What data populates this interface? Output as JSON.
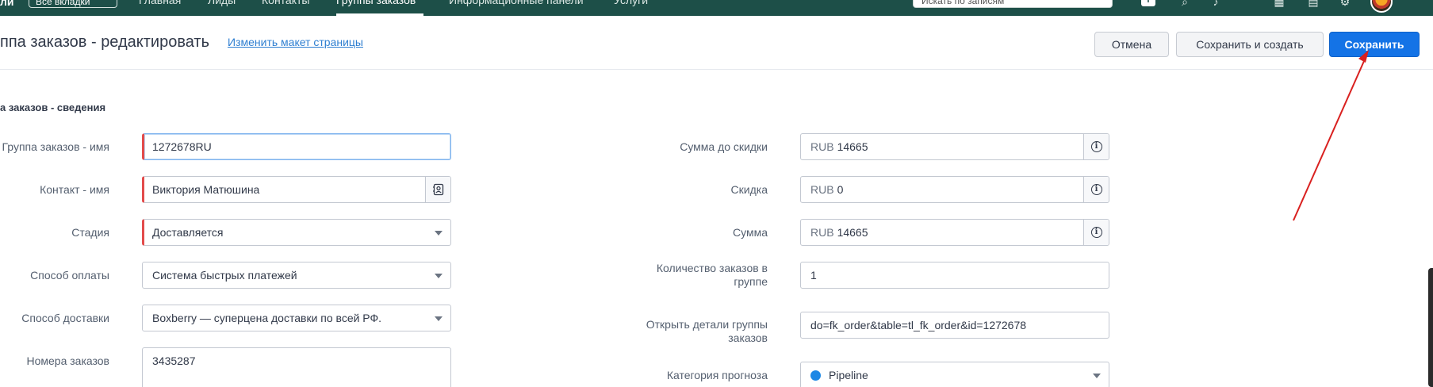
{
  "topnav": {
    "brand": "ли",
    "workspace": "Все вкладки",
    "tabs": [
      "Главная",
      "Лиды",
      "Контакты",
      "Группы заказов",
      "Информационные панели",
      "Услуги"
    ],
    "active_tab_index": 3,
    "search_placeholder": "Искать по записям",
    "icons": [
      "add-icon",
      "search-icon",
      "bell-icon",
      "calendar-icon",
      "apps-icon",
      "settings-icon",
      "avatar"
    ]
  },
  "header": {
    "title": "ппа заказов - редактировать",
    "layout_link": "Изменить макет страницы",
    "cancel_label": "Отмена",
    "save_new_label": "Сохранить и создать",
    "save_label": "Сохранить"
  },
  "section": {
    "title": "а заказов - сведения"
  },
  "left_fields": [
    {
      "label": "Группа заказов - имя",
      "value": "1272678RU",
      "required": true
    },
    {
      "label": "Контакт - имя",
      "value": "Виктория Матюшина",
      "required": true
    },
    {
      "label": "Стадия",
      "value": "Доставляется",
      "required": true
    },
    {
      "label": "Способ оплаты",
      "value": "Система быстрых платежей",
      "required": false
    },
    {
      "label": "Способ доставки",
      "value": "Boxberry — суперцена доставки по всей РФ.",
      "required": false
    },
    {
      "label": "Номера заказов",
      "value": "3435287",
      "required": false
    }
  ],
  "right_fields": [
    {
      "label": "Сумма до скидки",
      "currency": "RUB",
      "value": "14665"
    },
    {
      "label": "Скидка",
      "currency": "RUB",
      "value": "0"
    },
    {
      "label": "Сумма",
      "currency": "RUB",
      "value": "14665"
    },
    {
      "label": "Количество заказов в группе",
      "value": "1"
    },
    {
      "label": "Открыть детали группы заказов",
      "value": "do=fk_order&table=tl_fk_order&id=1272678"
    },
    {
      "label": "Категория прогноза",
      "value": "Pipeline"
    }
  ],
  "colors": {
    "topbar": "#1d4f48",
    "primary_button": "#1473e6",
    "required_marker": "#e34b4b",
    "annotation_arrow": "#d9201f",
    "pipeline_dot": "#1e88e5"
  }
}
